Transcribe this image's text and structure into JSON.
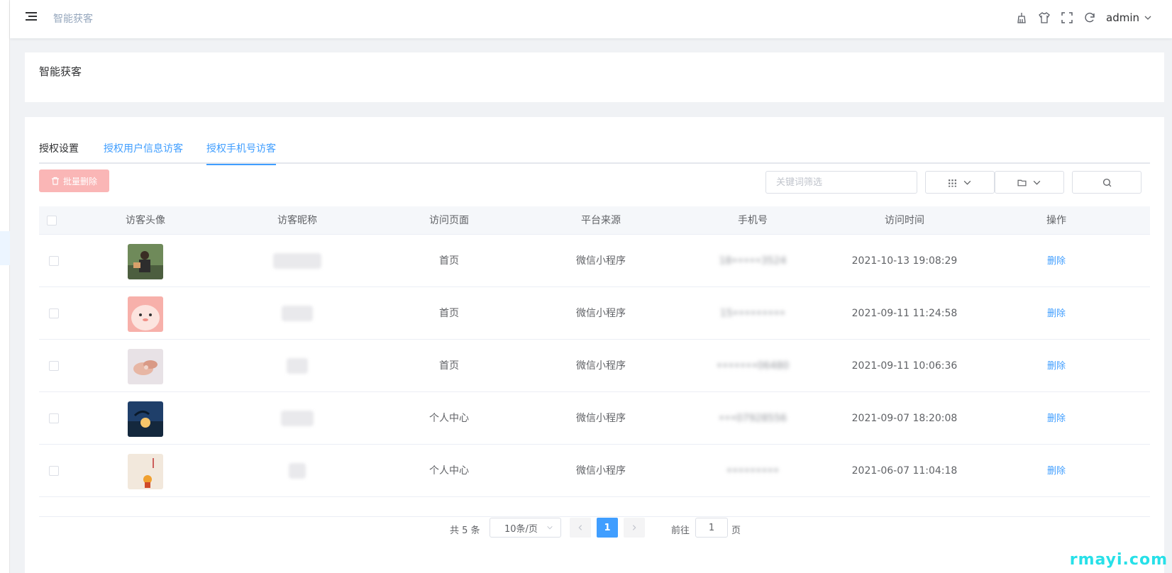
{
  "header": {
    "breadcrumb": "智能获客",
    "user": "admin",
    "icons": [
      "clean-icon",
      "theme-shirt-icon",
      "fullscreen-icon",
      "refresh-icon"
    ]
  },
  "title_card": {
    "title": "智能获客"
  },
  "tabs": [
    {
      "label": "授权设置",
      "active": false
    },
    {
      "label": "授权用户信息访客",
      "active": false
    },
    {
      "label": "授权手机号访客",
      "active": true
    }
  ],
  "toolbar": {
    "batch_delete": "批量删除",
    "search_placeholder": "关键词筛选"
  },
  "table": {
    "columns": [
      "访客头像",
      "访客昵称",
      "访问页面",
      "平台来源",
      "手机号",
      "访问时间",
      "操作"
    ],
    "rows": [
      {
        "avatar": "person-photo",
        "nickname": "[redacted]",
        "page": "首页",
        "platform": "微信小程序",
        "phone": "18•••••3524",
        "time": "2021-10-13 19:08:29",
        "action": "删除"
      },
      {
        "avatar": "pink-cartoon",
        "nickname": "[redacted]",
        "page": "首页",
        "platform": "微信小程序",
        "phone": "15•••••••••",
        "time": "2021-09-11 11:24:58",
        "action": "删除"
      },
      {
        "avatar": "hands-photo",
        "nickname": "[redacted]",
        "page": "首页",
        "platform": "微信小程序",
        "phone": "•••••••06480",
        "time": "2021-09-11 10:06:36",
        "action": "删除"
      },
      {
        "avatar": "dolphin-sunset",
        "nickname": "[redacted]",
        "page": "个人中心",
        "platform": "微信小程序",
        "phone": "•••07928556",
        "time": "2021-09-07 18:20:08",
        "action": "删除"
      },
      {
        "avatar": "cartoon-kid",
        "nickname": "[redacted]",
        "page": "个人中心",
        "platform": "微信小程序",
        "phone": "•••••••••",
        "time": "2021-06-07 11:04:18",
        "action": "删除"
      }
    ]
  },
  "pagination": {
    "total": "共 5 条",
    "page_size": "10条/页",
    "current": "1",
    "goto_prefix": "前往",
    "goto_value": "1",
    "goto_suffix": "页"
  },
  "watermark": "rmayi.com",
  "colors": {
    "primary": "#409eff",
    "danger_light": "#fab6b6",
    "highlight": "#e02020"
  }
}
